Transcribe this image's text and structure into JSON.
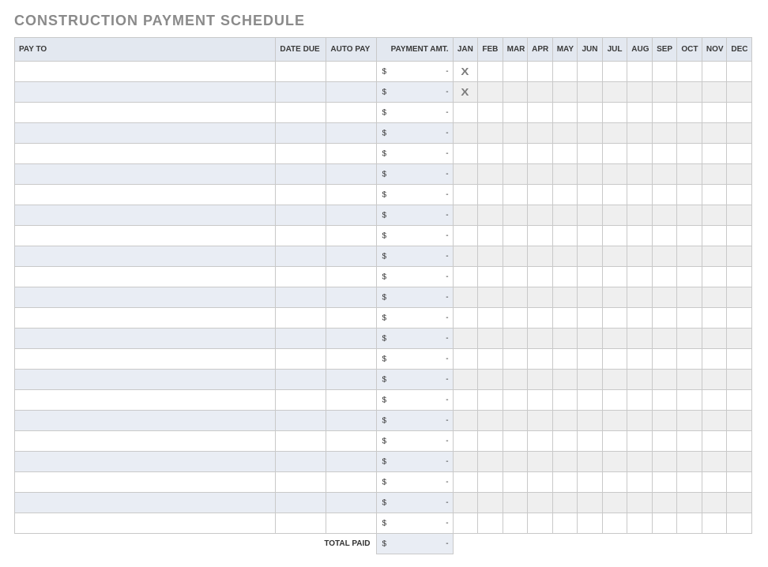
{
  "title": "CONSTRUCTION PAYMENT SCHEDULE",
  "columns": {
    "pay_to": "PAY TO",
    "date_due": "DATE DUE",
    "auto_pay": "AUTO PAY",
    "payment_amt": "PAYMENT AMT."
  },
  "months": [
    "JAN",
    "FEB",
    "MAR",
    "APR",
    "MAY",
    "JUN",
    "JUL",
    "AUG",
    "SEP",
    "OCT",
    "NOV",
    "DEC"
  ],
  "currency_symbol": "$",
  "empty_amount": "-",
  "check_glyph": "X",
  "rows": [
    {
      "pay_to": "",
      "date_due": "",
      "auto_pay": "",
      "amount": "-",
      "months": [
        true,
        false,
        false,
        false,
        false,
        false,
        false,
        false,
        false,
        false,
        false,
        false
      ]
    },
    {
      "pay_to": "",
      "date_due": "",
      "auto_pay": "",
      "amount": "-",
      "months": [
        true,
        false,
        false,
        false,
        false,
        false,
        false,
        false,
        false,
        false,
        false,
        false
      ]
    },
    {
      "pay_to": "",
      "date_due": "",
      "auto_pay": "",
      "amount": "-",
      "months": [
        false,
        false,
        false,
        false,
        false,
        false,
        false,
        false,
        false,
        false,
        false,
        false
      ]
    },
    {
      "pay_to": "",
      "date_due": "",
      "auto_pay": "",
      "amount": "-",
      "months": [
        false,
        false,
        false,
        false,
        false,
        false,
        false,
        false,
        false,
        false,
        false,
        false
      ]
    },
    {
      "pay_to": "",
      "date_due": "",
      "auto_pay": "",
      "amount": "-",
      "months": [
        false,
        false,
        false,
        false,
        false,
        false,
        false,
        false,
        false,
        false,
        false,
        false
      ]
    },
    {
      "pay_to": "",
      "date_due": "",
      "auto_pay": "",
      "amount": "-",
      "months": [
        false,
        false,
        false,
        false,
        false,
        false,
        false,
        false,
        false,
        false,
        false,
        false
      ]
    },
    {
      "pay_to": "",
      "date_due": "",
      "auto_pay": "",
      "amount": "-",
      "months": [
        false,
        false,
        false,
        false,
        false,
        false,
        false,
        false,
        false,
        false,
        false,
        false
      ]
    },
    {
      "pay_to": "",
      "date_due": "",
      "auto_pay": "",
      "amount": "-",
      "months": [
        false,
        false,
        false,
        false,
        false,
        false,
        false,
        false,
        false,
        false,
        false,
        false
      ]
    },
    {
      "pay_to": "",
      "date_due": "",
      "auto_pay": "",
      "amount": "-",
      "months": [
        false,
        false,
        false,
        false,
        false,
        false,
        false,
        false,
        false,
        false,
        false,
        false
      ]
    },
    {
      "pay_to": "",
      "date_due": "",
      "auto_pay": "",
      "amount": "-",
      "months": [
        false,
        false,
        false,
        false,
        false,
        false,
        false,
        false,
        false,
        false,
        false,
        false
      ]
    },
    {
      "pay_to": "",
      "date_due": "",
      "auto_pay": "",
      "amount": "-",
      "months": [
        false,
        false,
        false,
        false,
        false,
        false,
        false,
        false,
        false,
        false,
        false,
        false
      ]
    },
    {
      "pay_to": "",
      "date_due": "",
      "auto_pay": "",
      "amount": "-",
      "months": [
        false,
        false,
        false,
        false,
        false,
        false,
        false,
        false,
        false,
        false,
        false,
        false
      ]
    },
    {
      "pay_to": "",
      "date_due": "",
      "auto_pay": "",
      "amount": "-",
      "months": [
        false,
        false,
        false,
        false,
        false,
        false,
        false,
        false,
        false,
        false,
        false,
        false
      ]
    },
    {
      "pay_to": "",
      "date_due": "",
      "auto_pay": "",
      "amount": "-",
      "months": [
        false,
        false,
        false,
        false,
        false,
        false,
        false,
        false,
        false,
        false,
        false,
        false
      ]
    },
    {
      "pay_to": "",
      "date_due": "",
      "auto_pay": "",
      "amount": "-",
      "months": [
        false,
        false,
        false,
        false,
        false,
        false,
        false,
        false,
        false,
        false,
        false,
        false
      ]
    },
    {
      "pay_to": "",
      "date_due": "",
      "auto_pay": "",
      "amount": "-",
      "months": [
        false,
        false,
        false,
        false,
        false,
        false,
        false,
        false,
        false,
        false,
        false,
        false
      ]
    },
    {
      "pay_to": "",
      "date_due": "",
      "auto_pay": "",
      "amount": "-",
      "months": [
        false,
        false,
        false,
        false,
        false,
        false,
        false,
        false,
        false,
        false,
        false,
        false
      ]
    },
    {
      "pay_to": "",
      "date_due": "",
      "auto_pay": "",
      "amount": "-",
      "months": [
        false,
        false,
        false,
        false,
        false,
        false,
        false,
        false,
        false,
        false,
        false,
        false
      ]
    },
    {
      "pay_to": "",
      "date_due": "",
      "auto_pay": "",
      "amount": "-",
      "months": [
        false,
        false,
        false,
        false,
        false,
        false,
        false,
        false,
        false,
        false,
        false,
        false
      ]
    },
    {
      "pay_to": "",
      "date_due": "",
      "auto_pay": "",
      "amount": "-",
      "months": [
        false,
        false,
        false,
        false,
        false,
        false,
        false,
        false,
        false,
        false,
        false,
        false
      ]
    },
    {
      "pay_to": "",
      "date_due": "",
      "auto_pay": "",
      "amount": "-",
      "months": [
        false,
        false,
        false,
        false,
        false,
        false,
        false,
        false,
        false,
        false,
        false,
        false
      ]
    },
    {
      "pay_to": "",
      "date_due": "",
      "auto_pay": "",
      "amount": "-",
      "months": [
        false,
        false,
        false,
        false,
        false,
        false,
        false,
        false,
        false,
        false,
        false,
        false
      ]
    },
    {
      "pay_to": "",
      "date_due": "",
      "auto_pay": "",
      "amount": "-",
      "months": [
        false,
        false,
        false,
        false,
        false,
        false,
        false,
        false,
        false,
        false,
        false,
        false
      ]
    }
  ],
  "total": {
    "label": "TOTAL PAID",
    "amount": "-"
  }
}
